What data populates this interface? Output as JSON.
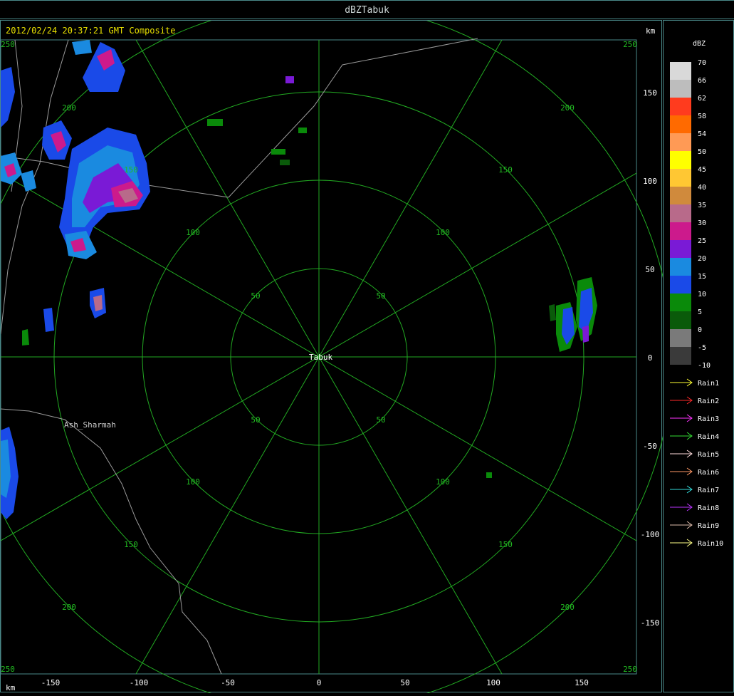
{
  "window": {
    "title": "dBZTabuk"
  },
  "header": {
    "timestamp": "2012/02/24 20:37:21 GMT Composite",
    "unit_top": "km",
    "unit_bottom": "km"
  },
  "x_ticks": [
    "-150",
    "-100",
    "-50",
    "0",
    "50",
    "100",
    "150"
  ],
  "y_ticks": [
    "150",
    "100",
    "50",
    "0",
    "-50",
    "-100",
    "-150"
  ],
  "corner_labels": [
    "250",
    "250",
    "250",
    "250"
  ],
  "ring_labels": [
    "50",
    "100",
    "150",
    "200"
  ],
  "places": {
    "center": "Tabuk",
    "west": "Ash_Sharmah"
  },
  "legend": {
    "title": "dBZ",
    "scale": [
      {
        "label": "70",
        "color": "#d9d9d9"
      },
      {
        "label": "66",
        "color": "#bdbdbd"
      },
      {
        "label": "62",
        "color": "#ff3b1e"
      },
      {
        "label": "58",
        "color": "#ff6a00"
      },
      {
        "label": "54",
        "color": "#ff9a55"
      },
      {
        "label": "50",
        "color": "#ffff00"
      },
      {
        "label": "45",
        "color": "#ffc733"
      },
      {
        "label": "40",
        "color": "#d08a3c"
      },
      {
        "label": "35",
        "color": "#b86a8a"
      },
      {
        "label": "30",
        "color": "#cc1a8c"
      },
      {
        "label": "25",
        "color": "#7a1ad6"
      },
      {
        "label": "20",
        "color": "#1a8ae0"
      },
      {
        "label": "15",
        "color": "#1a4ae8"
      },
      {
        "label": "10",
        "color": "#0a8a0a"
      },
      {
        "label": "5",
        "color": "#0a5a0a"
      },
      {
        "label": "0",
        "color": "#7a7a7a"
      },
      {
        "label": "-5",
        "color": "#3a3a3a"
      },
      {
        "label": "-10",
        "color": "#000000"
      }
    ],
    "rain": [
      {
        "label": "Rain1",
        "color": "#ffff33"
      },
      {
        "label": "Rain2",
        "color": "#ff2a2a"
      },
      {
        "label": "Rain3",
        "color": "#ff33ff"
      },
      {
        "label": "Rain4",
        "color": "#33dd33"
      },
      {
        "label": "Rain5",
        "color": "#ffdddd"
      },
      {
        "label": "Rain6",
        "color": "#ff9966"
      },
      {
        "label": "Rain7",
        "color": "#33dddd"
      },
      {
        "label": "Rain8",
        "color": "#bb33ff"
      },
      {
        "label": "Rain9",
        "color": "#ddbbaa"
      },
      {
        "label": "Rain10",
        "color": "#ffff88"
      }
    ]
  }
}
